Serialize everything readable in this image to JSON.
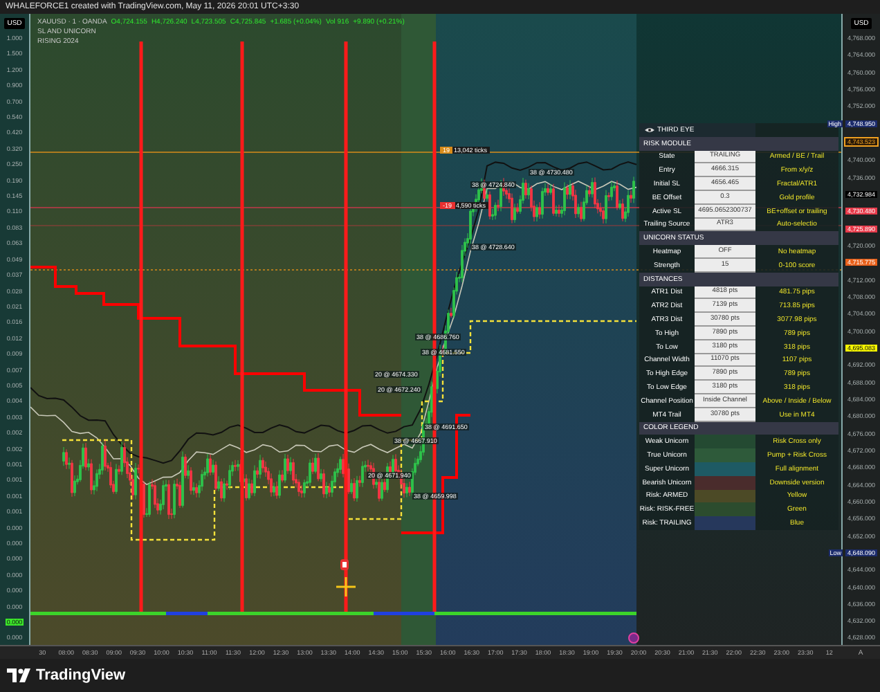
{
  "header": {
    "title": "WHALEFORCE1 created with TradingView.com, May 11, 2026 20:01 UTC+3:30"
  },
  "legend": {
    "symbol": "XAUUSD · 1 · OANDA",
    "values": [
      "O4,724.155",
      "H4,726.240",
      "L4,723.505",
      "C4,725.845",
      "+1.685 (+0.04%)",
      "Vol 916",
      "+9.890 (+0.21%)"
    ],
    "indicators": [
      "SL AND UNICORN",
      "RISING 2024"
    ]
  },
  "left_axis": {
    "currency": "USD",
    "labels": [
      {
        "text": "1.000",
        "kind": "tick"
      },
      {
        "text": "1.500",
        "kind": "tick"
      },
      {
        "text": "1.200",
        "kind": "tick"
      },
      {
        "text": "0.900",
        "kind": "tick"
      },
      {
        "text": "0.700",
        "kind": "tick"
      },
      {
        "text": "0.540",
        "kind": "tick"
      },
      {
        "text": "0.420",
        "kind": "tick"
      },
      {
        "text": "0.320",
        "kind": "tick"
      },
      {
        "text": "0.250",
        "kind": "tick"
      },
      {
        "text": "0.190",
        "kind": "tick"
      },
      {
        "text": "0.145",
        "kind": "tick"
      },
      {
        "text": "0.110",
        "kind": "tick"
      },
      {
        "text": "0.083",
        "kind": "tick"
      },
      {
        "text": "0.063",
        "kind": "tick"
      },
      {
        "text": "0.049",
        "kind": "tick"
      },
      {
        "text": "0.037",
        "kind": "tick"
      },
      {
        "text": "0.028",
        "kind": "tick"
      },
      {
        "text": "0.021",
        "kind": "tick"
      },
      {
        "text": "0.016",
        "kind": "tick"
      },
      {
        "text": "0.012",
        "kind": "tick"
      },
      {
        "text": "0.009",
        "kind": "tick"
      },
      {
        "text": "0.007",
        "kind": "tick"
      },
      {
        "text": "0.005",
        "kind": "tick"
      },
      {
        "text": "0.004",
        "kind": "tick"
      },
      {
        "text": "0.003",
        "kind": "tick"
      },
      {
        "text": "0.002",
        "kind": "tick"
      },
      {
        "text": "0.002",
        "kind": "tick"
      },
      {
        "text": "0.001",
        "kind": "tick"
      },
      {
        "text": "0.001",
        "kind": "tick"
      },
      {
        "text": "0.001",
        "kind": "tick"
      },
      {
        "text": "0.001",
        "kind": "tick"
      },
      {
        "text": "0.000",
        "kind": "tick"
      },
      {
        "text": "0.000",
        "kind": "tick"
      },
      {
        "text": "0.000",
        "kind": "tick"
      },
      {
        "text": "0.000",
        "kind": "tick"
      },
      {
        "text": "0.000",
        "kind": "tick"
      },
      {
        "text": "0.000",
        "kind": "tick"
      },
      {
        "text": "0.000",
        "kind": "green"
      },
      {
        "text": "0.000",
        "kind": "tick"
      }
    ]
  },
  "right_axis": {
    "currency": "USD",
    "labels": [
      {
        "text": "4,768.000",
        "kind": "tick"
      },
      {
        "text": "4,764.000",
        "kind": "tick"
      },
      {
        "text": "4,760.000",
        "kind": "tick"
      },
      {
        "text": "4,756.000",
        "kind": "tick"
      },
      {
        "text": "4,752.000",
        "kind": "tick"
      },
      {
        "text": "4,748.950",
        "kind": "high",
        "tag": "High"
      },
      {
        "text": "4,743.523",
        "kind": "outline"
      },
      {
        "text": "4,740.000",
        "kind": "tick"
      },
      {
        "text": "4,736.000",
        "kind": "tick"
      },
      {
        "text": "4,732.984",
        "kind": "dark"
      },
      {
        "text": "4,730.480",
        "kind": "red"
      },
      {
        "text": "4,725.890",
        "kind": "red"
      },
      {
        "text": "4,720.000",
        "kind": "tick"
      },
      {
        "text": "4,715.775",
        "kind": "orange"
      },
      {
        "text": "4,712.000",
        "kind": "tick"
      },
      {
        "text": "4,708.000",
        "kind": "tick"
      },
      {
        "text": "4,704.000",
        "kind": "tick"
      },
      {
        "text": "4,700.000",
        "kind": "tick"
      },
      {
        "text": "4,695.083",
        "kind": "yellow"
      },
      {
        "text": "4,692.000",
        "kind": "tick"
      },
      {
        "text": "4,688.000",
        "kind": "tick"
      },
      {
        "text": "4,684.000",
        "kind": "tick"
      },
      {
        "text": "4,680.000",
        "kind": "tick"
      },
      {
        "text": "4,676.000",
        "kind": "tick"
      },
      {
        "text": "4,672.000",
        "kind": "tick"
      },
      {
        "text": "4,668.000",
        "kind": "tick"
      },
      {
        "text": "4,664.000",
        "kind": "tick"
      },
      {
        "text": "4,660.000",
        "kind": "tick"
      },
      {
        "text": "4,656.000",
        "kind": "tick"
      },
      {
        "text": "4,652.000",
        "kind": "tick"
      },
      {
        "text": "4,648.090",
        "kind": "low",
        "tag": "Low"
      },
      {
        "text": "4,644.000",
        "kind": "tick"
      },
      {
        "text": "4,640.000",
        "kind": "tick"
      },
      {
        "text": "4,636.000",
        "kind": "tick"
      },
      {
        "text": "4,632.000",
        "kind": "tick"
      },
      {
        "text": "4,628.000",
        "kind": "tick"
      }
    ]
  },
  "chart_labels": [
    {
      "kind": "tag",
      "badge": "19",
      "text": "13,042 ticks"
    },
    {
      "kind": "plain",
      "text": "38 @ 4730.480"
    },
    {
      "kind": "plain",
      "text": "38 @ 4724.840"
    },
    {
      "kind": "tag_red",
      "badge": "-19",
      "text": "4,590 ticks"
    },
    {
      "kind": "plain",
      "text": "38 @ 4728.640"
    },
    {
      "kind": "plain",
      "text": "38 @ 4686.760"
    },
    {
      "kind": "plain",
      "text": "38 @ 4681.550"
    },
    {
      "kind": "plain",
      "text": "20 @ 4674.330"
    },
    {
      "kind": "plain",
      "text": "20 @ 4672.240"
    },
    {
      "kind": "plain",
      "text": "38 @ 4691.650"
    },
    {
      "kind": "plain",
      "text": "38 @ 4667.910"
    },
    {
      "kind": "plain",
      "text": "20 @ 4671.940"
    },
    {
      "kind": "plain",
      "text": "38 @ 4659.998"
    }
  ],
  "panel": {
    "title": "THIRD EYE",
    "sections": [
      {
        "title": "RISK MODULE",
        "rows": [
          {
            "kind": "value",
            "label": "State",
            "value": "TRAILING",
            "note": "Armed / BE / Trail"
          },
          {
            "kind": "value",
            "label": "Entry",
            "value": "4666.315",
            "note": "From x/y/z"
          },
          {
            "kind": "value",
            "label": "Initial SL",
            "value": "4656.465",
            "note": "Fractal/ATR1"
          },
          {
            "kind": "value",
            "label": "BE Offset",
            "value": "0.3",
            "note": "Gold profile"
          },
          {
            "kind": "value",
            "label": "Active SL",
            "value": "4695.0652300737",
            "note": "BE+offset or trailing"
          },
          {
            "kind": "value",
            "label": "Trailing Source",
            "value": "ATR3",
            "note": "Auto-selectio"
          }
        ]
      },
      {
        "title": "UNICORN STATUS",
        "rows": [
          {
            "kind": "value",
            "label": "Heatmap",
            "value": "OFF",
            "note": "No heatmap"
          },
          {
            "kind": "value",
            "label": "Strength",
            "value": "15",
            "note": "0-100 score"
          }
        ]
      },
      {
        "title": "DISTANCES",
        "rows": [
          {
            "kind": "value",
            "label": "ATR1 Dist",
            "value": "4818 pts",
            "note": "481.75 pips"
          },
          {
            "kind": "value",
            "label": "ATR2 Dist",
            "value": "7139 pts",
            "note": "713.85 pips"
          },
          {
            "kind": "value",
            "label": "ATR3 Dist",
            "value": "30780 pts",
            "note": "3077.98 pips"
          },
          {
            "kind": "value",
            "label": "To High",
            "value": "7890 pts",
            "note": "789 pips"
          },
          {
            "kind": "value",
            "label": "To Low",
            "value": "3180 pts",
            "note": "318 pips"
          },
          {
            "kind": "value",
            "label": "Channel Width",
            "value": "11070 pts",
            "note": "1107 pips"
          },
          {
            "kind": "value",
            "label": "To High Edge",
            "value": "7890 pts",
            "note": "789 pips"
          },
          {
            "kind": "value",
            "label": "To Low Edge",
            "value": "3180 pts",
            "note": "318 pips"
          },
          {
            "kind": "value",
            "label": "Channel Position",
            "value": "Inside Channel",
            "note": "Above / Inside / Below"
          },
          {
            "kind": "value",
            "label": "MT4 Trail",
            "value": "30780 pts",
            "note": "Use in MT4"
          }
        ]
      },
      {
        "title": "COLOR LEGEND",
        "rows": [
          {
            "kind": "swatch",
            "label": "Weak Unicorn",
            "color": "#244a32",
            "note": "Risk Cross only"
          },
          {
            "kind": "swatch",
            "label": "True Unicorn",
            "color": "#2e5a3a",
            "note": "Pump + Risk Cross"
          },
          {
            "kind": "swatch",
            "label": "Super Unicorn",
            "color": "#1e5a64",
            "note": "Full alignment"
          },
          {
            "kind": "swatch",
            "label": "Bearish Unicorn",
            "color": "#4a2c2c",
            "note": "Downside version"
          },
          {
            "kind": "swatch",
            "label": "Risk: ARMED",
            "color": "#4c4a26",
            "note": "Yellow"
          },
          {
            "kind": "swatch",
            "label": "Risk: RISK-FREE",
            "color": "#2c4c2e",
            "note": "Green"
          },
          {
            "kind": "swatch",
            "label": "Risk: TRAILING",
            "color": "#26385c",
            "note": "Blue"
          }
        ]
      }
    ]
  },
  "time_axis": {
    "labels": [
      "30",
      "08:00",
      "08:30",
      "09:00",
      "09:30",
      "10:00",
      "10:30",
      "11:00",
      "11:30",
      "12:00",
      "12:30",
      "13:00",
      "13:30",
      "14:00",
      "14:30",
      "15:00",
      "15:30",
      "16:00",
      "16:30",
      "17:00",
      "17:30",
      "18:00",
      "18:30",
      "19:00",
      "19:30",
      "20:00",
      "20:30",
      "21:00",
      "21:30",
      "22:00",
      "22:30",
      "23:00",
      "23:30",
      "12"
    ],
    "corner": "A"
  },
  "footer": {
    "brand": "TradingView"
  }
}
